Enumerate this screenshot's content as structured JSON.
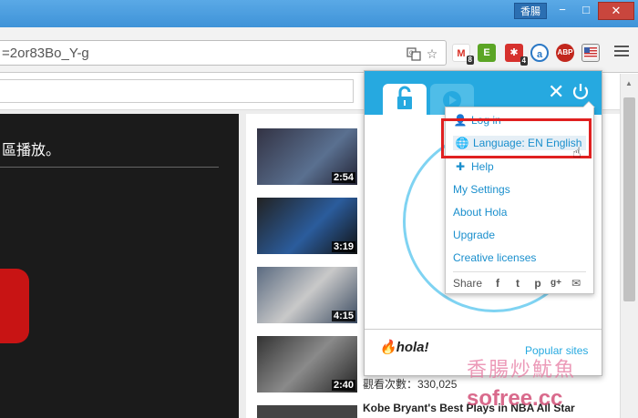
{
  "window": {
    "title_tag": "香腸",
    "minimize": "−",
    "maximize": "□",
    "close": "✕"
  },
  "toolbar": {
    "url": "=2or83Bo_Y-g",
    "extensions": [
      {
        "name": "gmail",
        "badge": "8",
        "color": "#d93025",
        "glyph": "M"
      },
      {
        "name": "evernote",
        "badge": "",
        "color": "#5ba525",
        "glyph": "E"
      },
      {
        "name": "huawei",
        "badge": "4",
        "color": "#d6312d",
        "glyph": "✱"
      },
      {
        "name": "avast",
        "badge": "",
        "color": "#2b78c5",
        "glyph": "a"
      },
      {
        "name": "adblock",
        "badge": "",
        "color": "#c2271d",
        "glyph": "ABP"
      },
      {
        "name": "hola",
        "badge": "",
        "color": "#3c5fa8",
        "glyph": ""
      }
    ]
  },
  "page": {
    "video_text": "區播放。",
    "durations": [
      "2:54",
      "3:19",
      "4:15",
      "2:40"
    ],
    "views": "觀看次數：330,025",
    "next_title": "Kobe Bryant's Best Plays in NBA All Star"
  },
  "hola": {
    "popular_sites": "Popular sites",
    "logo": "hola!",
    "menu": {
      "login": "Log in",
      "language": "Language: EN English",
      "help": "Help",
      "settings": "My Settings",
      "about": "About Hola",
      "upgrade": "Upgrade",
      "licenses": "Creative licenses",
      "share": "Share"
    }
  },
  "watermark": {
    "text": "香腸炒魷魚",
    "site": "sofree.cc"
  }
}
